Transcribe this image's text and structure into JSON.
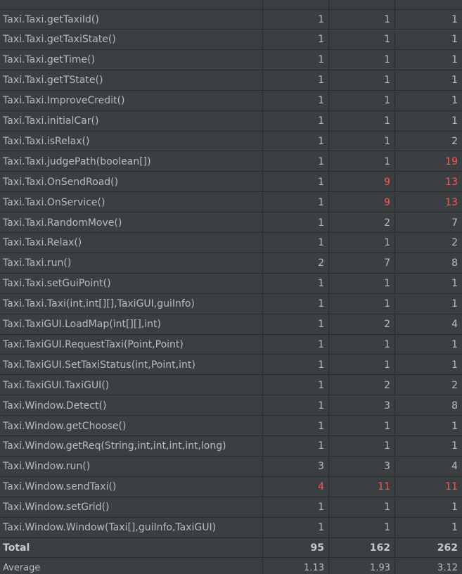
{
  "header_partial": [
    "",
    "",
    "",
    ""
  ],
  "rows": [
    {
      "method": "Taxi.Taxi.getTaxiId()",
      "v1": "1",
      "v2": "1",
      "v3": "1",
      "h1": false,
      "h2": false,
      "h3": false
    },
    {
      "method": "Taxi.Taxi.getTaxiState()",
      "v1": "1",
      "v2": "1",
      "v3": "1",
      "h1": false,
      "h2": false,
      "h3": false
    },
    {
      "method": "Taxi.Taxi.getTime()",
      "v1": "1",
      "v2": "1",
      "v3": "1",
      "h1": false,
      "h2": false,
      "h3": false
    },
    {
      "method": "Taxi.Taxi.getTState()",
      "v1": "1",
      "v2": "1",
      "v3": "1",
      "h1": false,
      "h2": false,
      "h3": false
    },
    {
      "method": "Taxi.Taxi.ImproveCredit()",
      "v1": "1",
      "v2": "1",
      "v3": "1",
      "h1": false,
      "h2": false,
      "h3": false
    },
    {
      "method": "Taxi.Taxi.initialCar()",
      "v1": "1",
      "v2": "1",
      "v3": "1",
      "h1": false,
      "h2": false,
      "h3": false
    },
    {
      "method": "Taxi.Taxi.isRelax()",
      "v1": "1",
      "v2": "1",
      "v3": "2",
      "h1": false,
      "h2": false,
      "h3": false
    },
    {
      "method": "Taxi.Taxi.judgePath(boolean[])",
      "v1": "1",
      "v2": "1",
      "v3": "19",
      "h1": false,
      "h2": false,
      "h3": true
    },
    {
      "method": "Taxi.Taxi.OnSendRoad()",
      "v1": "1",
      "v2": "9",
      "v3": "13",
      "h1": false,
      "h2": true,
      "h3": true
    },
    {
      "method": "Taxi.Taxi.OnService()",
      "v1": "1",
      "v2": "9",
      "v3": "13",
      "h1": false,
      "h2": true,
      "h3": true
    },
    {
      "method": "Taxi.Taxi.RandomMove()",
      "v1": "1",
      "v2": "2",
      "v3": "7",
      "h1": false,
      "h2": false,
      "h3": false
    },
    {
      "method": "Taxi.Taxi.Relax()",
      "v1": "1",
      "v2": "1",
      "v3": "2",
      "h1": false,
      "h2": false,
      "h3": false
    },
    {
      "method": "Taxi.Taxi.run()",
      "v1": "2",
      "v2": "7",
      "v3": "8",
      "h1": false,
      "h2": false,
      "h3": false
    },
    {
      "method": "Taxi.Taxi.setGuiPoint()",
      "v1": "1",
      "v2": "1",
      "v3": "1",
      "h1": false,
      "h2": false,
      "h3": false
    },
    {
      "method": "Taxi.Taxi.Taxi(int,int[][],TaxiGUI,guiInfo)",
      "v1": "1",
      "v2": "1",
      "v3": "1",
      "h1": false,
      "h2": false,
      "h3": false
    },
    {
      "method": "Taxi.TaxiGUI.LoadMap(int[][],int)",
      "v1": "1",
      "v2": "2",
      "v3": "4",
      "h1": false,
      "h2": false,
      "h3": false
    },
    {
      "method": "Taxi.TaxiGUI.RequestTaxi(Point,Point)",
      "v1": "1",
      "v2": "1",
      "v3": "1",
      "h1": false,
      "h2": false,
      "h3": false
    },
    {
      "method": "Taxi.TaxiGUI.SetTaxiStatus(int,Point,int)",
      "v1": "1",
      "v2": "1",
      "v3": "1",
      "h1": false,
      "h2": false,
      "h3": false
    },
    {
      "method": "Taxi.TaxiGUI.TaxiGUI()",
      "v1": "1",
      "v2": "2",
      "v3": "2",
      "h1": false,
      "h2": false,
      "h3": false
    },
    {
      "method": "Taxi.Window.Detect()",
      "v1": "1",
      "v2": "3",
      "v3": "8",
      "h1": false,
      "h2": false,
      "h3": false
    },
    {
      "method": "Taxi.Window.getChoose()",
      "v1": "1",
      "v2": "1",
      "v3": "1",
      "h1": false,
      "h2": false,
      "h3": false
    },
    {
      "method": "Taxi.Window.getReq(String,int,int,int,int,long)",
      "v1": "1",
      "v2": "1",
      "v3": "1",
      "h1": false,
      "h2": false,
      "h3": false
    },
    {
      "method": "Taxi.Window.run()",
      "v1": "3",
      "v2": "3",
      "v3": "4",
      "h1": false,
      "h2": false,
      "h3": false
    },
    {
      "method": "Taxi.Window.sendTaxi()",
      "v1": "4",
      "v2": "11",
      "v3": "11",
      "h1": true,
      "h2": true,
      "h3": true
    },
    {
      "method": "Taxi.Window.setGrid()",
      "v1": "1",
      "v2": "1",
      "v3": "1",
      "h1": false,
      "h2": false,
      "h3": false
    },
    {
      "method": "Taxi.Window.Window(Taxi[],guiInfo,TaxiGUI)",
      "v1": "1",
      "v2": "1",
      "v3": "1",
      "h1": false,
      "h2": false,
      "h3": false
    }
  ],
  "total": {
    "label": "Total",
    "v1": "95",
    "v2": "162",
    "v3": "262"
  },
  "average": {
    "label": "Average",
    "v1": "1.13",
    "v2": "1.93",
    "v3": "3.12"
  },
  "colors": {
    "background": "#3c3f41",
    "text": "#bbbbbb",
    "highlight": "#ff5555",
    "grid": "#2b2b2b"
  }
}
